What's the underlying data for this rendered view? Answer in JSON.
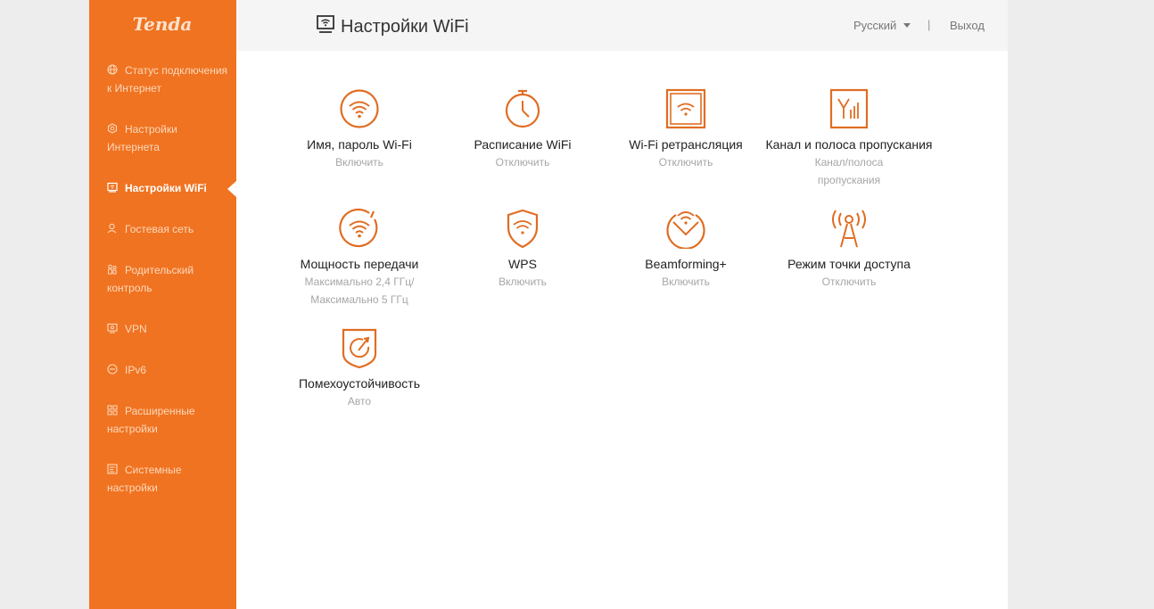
{
  "brand": {
    "logo_text": "Tenda",
    "accent": "#f07321",
    "icon_color": "#e06d22"
  },
  "header": {
    "title": "Настройки WiFi",
    "title_icon": "router-screen-icon",
    "language": "Русский",
    "separator": "|",
    "logout": "Выход"
  },
  "sidebar": {
    "items": [
      {
        "label": "Статус подключения к Интернет",
        "icon": "globe-icon",
        "active": false
      },
      {
        "label": "Настройки Интернета",
        "icon": "internet-settings-icon",
        "active": false
      },
      {
        "label": "Настройки WiFi",
        "icon": "wifi-screen-icon",
        "active": true
      },
      {
        "label": "Гостевая сеть",
        "icon": "guest-user-icon",
        "active": false
      },
      {
        "label": "Родительский контроль",
        "icon": "parental-icon",
        "active": false
      },
      {
        "label": "VPN",
        "icon": "vpn-icon",
        "active": false
      },
      {
        "label": "IPv6",
        "icon": "ipv6-icon",
        "active": false
      },
      {
        "label": "Расширенные настройки",
        "icon": "grid-icon",
        "active": false
      },
      {
        "label": "Системные настройки",
        "icon": "system-icon",
        "active": false
      }
    ]
  },
  "tiles": [
    {
      "title": "Имя, пароль Wi-Fi",
      "status": "Включить",
      "icon": "wifi-circle-icon"
    },
    {
      "title": "Расписание WiFi",
      "status": "Отключить",
      "icon": "timer-icon"
    },
    {
      "title": "Wi-Fi ретрансляция",
      "status": "Отключить",
      "icon": "wifi-repeater-icon"
    },
    {
      "title": "Канал и полоса пропускания",
      "status": "Канал/полоса\nпропускания",
      "icon": "channel-bandwidth-icon"
    },
    {
      "title": "Мощность передачи",
      "status": "Максимально 2,4 ГГц/\nМаксимально 5 ГГц",
      "icon": "transmit-power-icon"
    },
    {
      "title": "WPS",
      "status": "Включить",
      "icon": "wps-shield-icon"
    },
    {
      "title": "Beamforming+",
      "status": "Включить",
      "icon": "beamforming-icon"
    },
    {
      "title": "Режим точки доступа",
      "status": "Отключить",
      "icon": "access-point-icon"
    },
    {
      "title": "Помехоустойчивость",
      "status": "Авто",
      "icon": "interference-shield-icon"
    }
  ]
}
